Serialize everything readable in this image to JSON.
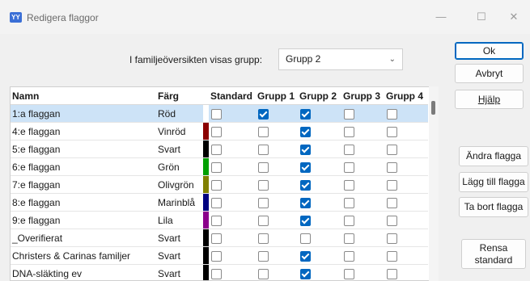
{
  "window": {
    "title": "Redigera flaggor",
    "icon": "app-family-tree-icon"
  },
  "group_selector": {
    "label": "I familjeöversikten visas grupp:",
    "value": "Grupp 2"
  },
  "buttons": {
    "ok": "Ok",
    "cancel": "Avbryt",
    "help": "Hjälp",
    "edit_flag": "Ändra flagga",
    "add_flag": "Lägg till flagga",
    "remove_flag": "Ta bort flagga",
    "clear_standard": "Rensa standard"
  },
  "table": {
    "columns": [
      "Namn",
      "Färg",
      "Standard",
      "Grupp 1",
      "Grupp 2",
      "Grupp 3",
      "Grupp 4"
    ],
    "rows": [
      {
        "name": "1:a flaggan",
        "color": "Röd",
        "swatch": "#ffffff",
        "standard": false,
        "g1": true,
        "g2": true,
        "g3": false,
        "g4": false,
        "selected": true
      },
      {
        "name": "4:e flaggan",
        "color": "Vinröd",
        "swatch": "#8b0000",
        "standard": false,
        "g1": false,
        "g2": true,
        "g3": false,
        "g4": false
      },
      {
        "name": "5:e flaggan",
        "color": "Svart",
        "swatch": "#000000",
        "standard": false,
        "g1": false,
        "g2": true,
        "g3": false,
        "g4": false
      },
      {
        "name": "6:e flaggan",
        "color": "Grön",
        "swatch": "#00a000",
        "standard": false,
        "g1": false,
        "g2": true,
        "g3": false,
        "g4": false
      },
      {
        "name": "7:e flaggan",
        "color": "Olivgrön",
        "swatch": "#808000",
        "standard": false,
        "g1": false,
        "g2": true,
        "g3": false,
        "g4": false
      },
      {
        "name": "8:e flaggan",
        "color": "Marinblå",
        "swatch": "#000080",
        "standard": false,
        "g1": false,
        "g2": true,
        "g3": false,
        "g4": false
      },
      {
        "name": "9:e flaggan",
        "color": "Lila",
        "swatch": "#8b008b",
        "standard": false,
        "g1": false,
        "g2": true,
        "g3": false,
        "g4": false
      },
      {
        "name": "_Overifierat",
        "color": "Svart",
        "swatch": "#000000",
        "standard": false,
        "g1": false,
        "g2": false,
        "g3": false,
        "g4": false
      },
      {
        "name": "Christers & Carinas familjer",
        "color": "Svart",
        "swatch": "#000000",
        "standard": false,
        "g1": false,
        "g2": true,
        "g3": false,
        "g4": false
      },
      {
        "name": "DNA-släkting ev",
        "color": "Svart",
        "swatch": "#000000",
        "standard": false,
        "g1": false,
        "g2": true,
        "g3": false,
        "g4": false
      }
    ]
  }
}
